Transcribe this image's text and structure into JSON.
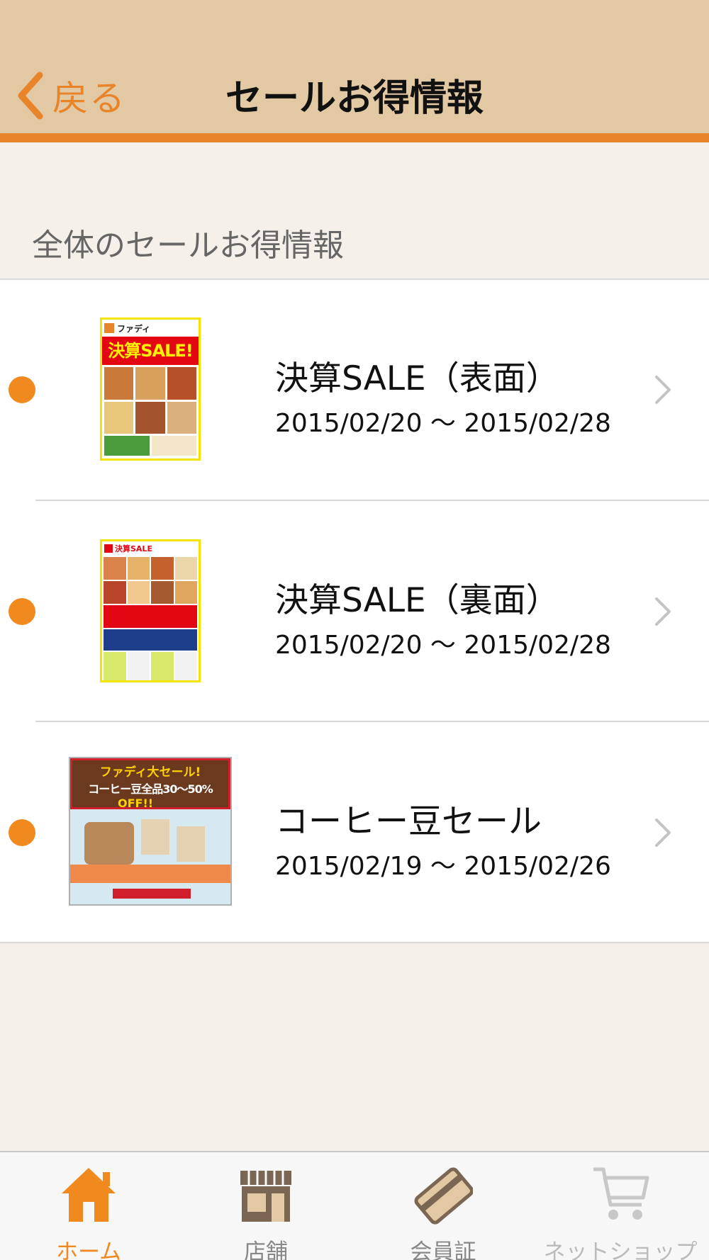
{
  "navbar": {
    "back_label": "戻る",
    "title": "セールお得情報"
  },
  "section": {
    "header": "全体のセールお得情報"
  },
  "sales": [
    {
      "title": "決算SALE（表面）",
      "date_range": "2015/02/20 〜 2015/02/28",
      "thumbnail_text": "決算SALE!",
      "thumbnail_brand": "ファディ"
    },
    {
      "title": "決算SALE（裏面）",
      "date_range": "2015/02/20 〜 2015/02/28",
      "thumbnail_brand": "決算SALE"
    },
    {
      "title": "コーヒー豆セール",
      "date_range": "2015/02/19 〜 2015/02/26",
      "thumbnail_line1": "ファディ大セール!",
      "thumbnail_line2": "コーヒー豆全品30〜50%",
      "thumbnail_line3": "OFF!!"
    }
  ],
  "tabbar": {
    "tabs": [
      {
        "label": "ホーム",
        "icon": "home-icon",
        "active": true
      },
      {
        "label": "店舗",
        "icon": "store-icon",
        "active": false
      },
      {
        "label": "会員証",
        "icon": "member-card-icon",
        "active": false
      },
      {
        "label": "ネットショップ",
        "icon": "cart-icon",
        "active": false
      }
    ]
  },
  "colors": {
    "accent": "#e8852a",
    "navbar_bg": "#e3c8a4",
    "page_bg": "#f5f0ea",
    "dot": "#f08a1e"
  }
}
